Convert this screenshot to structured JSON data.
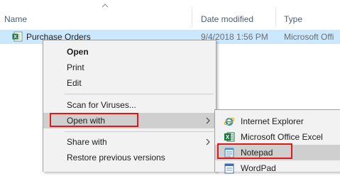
{
  "columns": {
    "name": "Name",
    "date_modified": "Date modified",
    "type": "Type"
  },
  "file": {
    "name": "Purchase Orders",
    "date_modified": "9/4/2018 1:56 PM",
    "type": "Microsoft Offi"
  },
  "context_menu": {
    "items": [
      {
        "label": "Open",
        "bold": true
      },
      {
        "label": "Print"
      },
      {
        "label": "Edit"
      },
      {
        "label": "Scan for Viruses..."
      },
      {
        "label": "Open with",
        "submenu": true,
        "highlighted": true
      },
      {
        "label": "Share with",
        "submenu": true
      },
      {
        "label": "Restore previous versions"
      }
    ]
  },
  "open_with_submenu": {
    "items": [
      {
        "label": "Internet Explorer",
        "icon": "internet-explorer-icon"
      },
      {
        "label": "Microsoft Office Excel",
        "icon": "excel-icon"
      },
      {
        "label": "Notepad",
        "icon": "notepad-icon",
        "highlighted": true
      },
      {
        "label": "WordPad",
        "icon": "wordpad-icon"
      }
    ]
  },
  "colors": {
    "selection": "#cce8ff",
    "menu_bg": "#f2f2f2",
    "menu_highlight": "#cfcfcf",
    "annotation_red": "#e01818"
  }
}
